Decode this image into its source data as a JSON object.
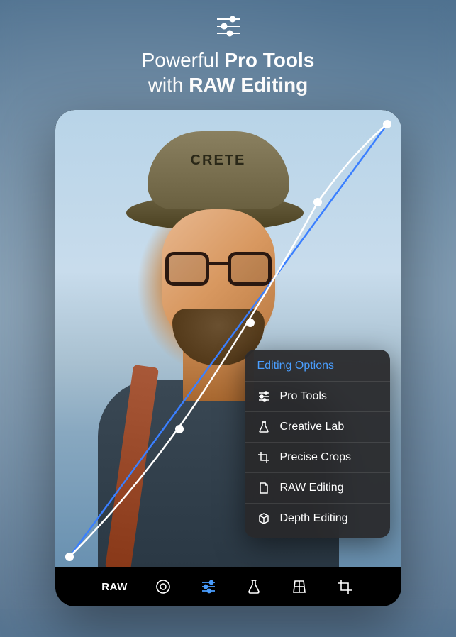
{
  "headline": {
    "line1_light": "Powerful ",
    "line1_bold": "Pro Tools",
    "line2_light": "with ",
    "line2_bold": "RAW Editing"
  },
  "photo": {
    "cap_text": "CRETE"
  },
  "popup": {
    "title": "Editing Options",
    "items": [
      {
        "label": "Pro Tools",
        "icon": "sliders"
      },
      {
        "label": "Creative Lab",
        "icon": "flask"
      },
      {
        "label": "Precise Crops",
        "icon": "crop"
      },
      {
        "label": "RAW Editing",
        "icon": "file"
      },
      {
        "label": "Depth Editing",
        "icon": "cube"
      }
    ]
  },
  "toolbar": {
    "raw_label": "RAW",
    "active_index": 2,
    "items": [
      {
        "icon": "raw"
      },
      {
        "icon": "aperture"
      },
      {
        "icon": "sliders"
      },
      {
        "icon": "flask"
      },
      {
        "icon": "perspective"
      },
      {
        "icon": "crop"
      }
    ]
  },
  "colors": {
    "accent": "#4a9eff"
  }
}
